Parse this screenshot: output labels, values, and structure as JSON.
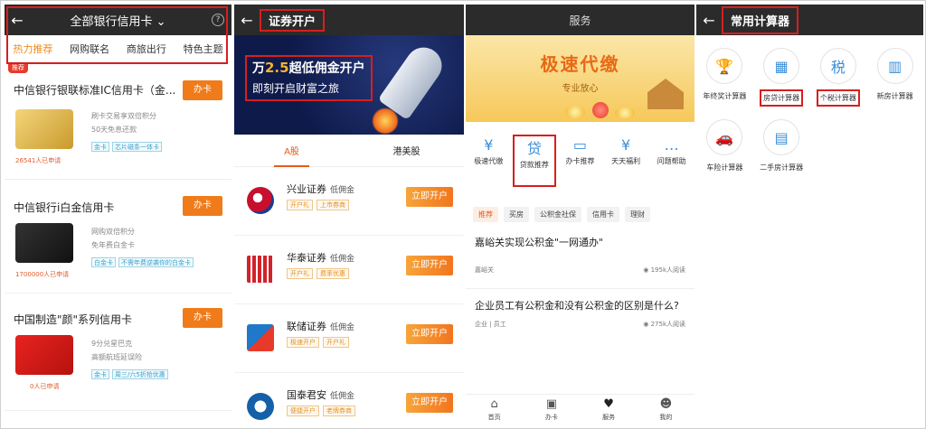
{
  "panel1": {
    "title": "全部银行信用卡",
    "help": "?",
    "tabs": [
      "热力推荐",
      "网购联名",
      "商旅出行",
      "特色主题"
    ],
    "badge": "推荐",
    "cards": [
      {
        "title": "中信银行银联标准IC信用卡（金...",
        "button": "办卡",
        "desc": [
          "刷卡交易享双倍积分",
          "50天免息还款"
        ],
        "tags": [
          "金卡",
          "芯片磁条一体卡"
        ],
        "applied": "26541人已申请"
      },
      {
        "title": "中信银行i白金信用卡",
        "button": "办卡",
        "desc": [
          "网购双倍积分",
          "免年费白金卡"
        ],
        "tags": [
          "白金卡",
          "不需年费逆袭你的白金卡"
        ],
        "applied": "1700000人已申请"
      },
      {
        "title": "中国制造\"颜\"系列信用卡",
        "button": "办卡",
        "desc": [
          "9分兑星巴克",
          "高额航班延误险"
        ],
        "tags": [
          "金卡",
          "周三/六5折抢优惠"
        ],
        "applied": "0人已申请"
      }
    ]
  },
  "panel2": {
    "title": "证券开户",
    "banner_line1_prefix": "万",
    "banner_line1_big": "2.5",
    "banner_line1_suffix": "超低佣金开户",
    "banner_line2": "即刻开启财富之旅",
    "tabs": [
      "A股",
      "港美股"
    ],
    "brokers": [
      {
        "name": "兴业证券",
        "sub": "低佣金",
        "tags": [
          "开户礼",
          "上市券商"
        ],
        "button": "立即开户",
        "color": "#c8102e"
      },
      {
        "name": "华泰证券",
        "sub": "低佣金",
        "tags": [
          "开户礼",
          "费率优惠"
        ],
        "button": "立即开户",
        "color": "#d2232a"
      },
      {
        "name": "联储证券",
        "sub": "低佣金",
        "tags": [
          "极速开户",
          "开户礼"
        ],
        "button": "立即开户",
        "color": "#1f78c8"
      },
      {
        "name": "国泰君安",
        "sub": "低佣金",
        "tags": [
          "便捷开户",
          "老牌券商"
        ],
        "button": "立即开户",
        "color": "#1560a8"
      }
    ]
  },
  "panel3": {
    "title": "服务",
    "banner_title": "极速代缴",
    "banner_sub": "专业放心",
    "icons": [
      {
        "label": "极速代缴",
        "sym": "¥"
      },
      {
        "label": "贷款推荐",
        "sym": "贷"
      },
      {
        "label": "办卡推荐",
        "sym": "▭"
      },
      {
        "label": "天天福利",
        "sym": "¥"
      },
      {
        "label": "问题帮助",
        "sym": "…"
      }
    ],
    "pills": [
      "推荐",
      "买房",
      "公积金社保",
      "信用卡",
      "理财"
    ],
    "news": [
      {
        "title": "嘉峪关实现公积金\"一网通办\"",
        "source": "嘉峪关",
        "reads": "195k人阅读"
      },
      {
        "title": "企业员工有公积金和没有公积金的区别是什么?",
        "source": "企业 | 员工",
        "reads": "275k人阅读"
      }
    ],
    "nav": [
      "首页",
      "办卡",
      "服务",
      "我的"
    ]
  },
  "panel4": {
    "title": "常用计算器",
    "calcs": [
      {
        "label": "年终奖计算器",
        "sym": "🏆"
      },
      {
        "label": "房贷计算器",
        "sym": "▦"
      },
      {
        "label": "个税计算器",
        "sym": "税"
      },
      {
        "label": "新房计算器",
        "sym": "▥"
      },
      {
        "label": "车险计算器",
        "sym": "🚗"
      },
      {
        "label": "二手房计算器",
        "sym": "▤"
      }
    ]
  }
}
